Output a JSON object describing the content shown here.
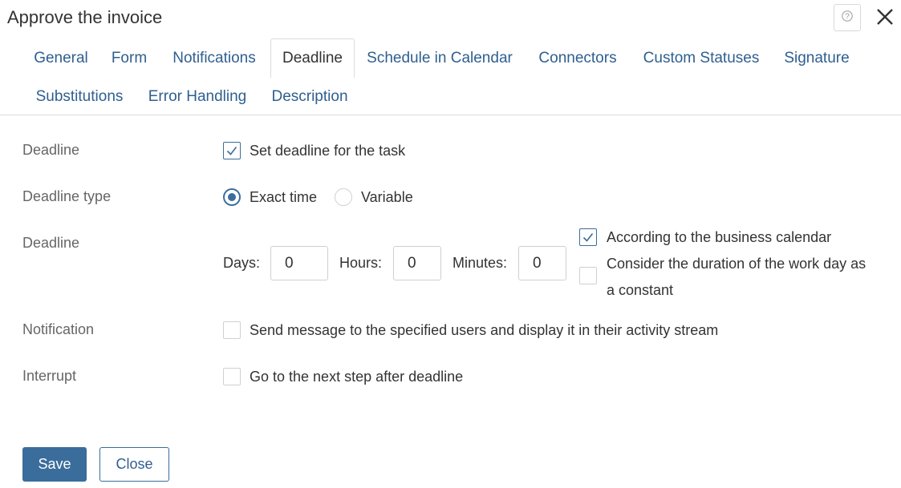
{
  "window": {
    "title": "Approve the invoice",
    "help_icon": "question-icon",
    "close_icon": "close-icon"
  },
  "tabs": [
    {
      "label": "General",
      "active": false
    },
    {
      "label": "Form",
      "active": false
    },
    {
      "label": "Notifications",
      "active": false
    },
    {
      "label": "Deadline",
      "active": true
    },
    {
      "label": "Schedule in Calendar",
      "active": false
    },
    {
      "label": "Connectors",
      "active": false
    },
    {
      "label": "Custom Statuses",
      "active": false
    },
    {
      "label": "Signature",
      "active": false
    },
    {
      "label": "Substitutions",
      "active": false
    },
    {
      "label": "Error Handling",
      "active": false
    },
    {
      "label": "Description",
      "active": false
    }
  ],
  "form": {
    "deadline": {
      "label": "Deadline",
      "checkbox_label": "Set deadline for the task",
      "checked": true
    },
    "deadline_type": {
      "label": "Deadline type",
      "options": [
        {
          "label": "Exact time",
          "selected": true
        },
        {
          "label": "Variable",
          "selected": false
        }
      ]
    },
    "deadline_time": {
      "label": "Deadline",
      "days_label": "Days:",
      "days_value": "0",
      "hours_label": "Hours:",
      "hours_value": "0",
      "minutes_label": "Minutes:",
      "minutes_value": "0",
      "business_calendar_label": "According to the business calendar",
      "business_calendar_checked": true,
      "constant_day_label_line1": "Consider the duration of the work day as",
      "constant_day_label_line2": "a constant",
      "constant_day_checked": false
    },
    "notification": {
      "label": "Notification",
      "checkbox_label": "Send message to the specified users and display it in their activity stream",
      "checked": false
    },
    "interrupt": {
      "label": "Interrupt",
      "checkbox_label": "Go to the next step after deadline",
      "checked": false
    }
  },
  "footer": {
    "save_label": "Save",
    "close_label": "Close"
  },
  "colors": {
    "accent": "#3a6d9b",
    "link": "#2f5f8f",
    "label": "#666666"
  }
}
